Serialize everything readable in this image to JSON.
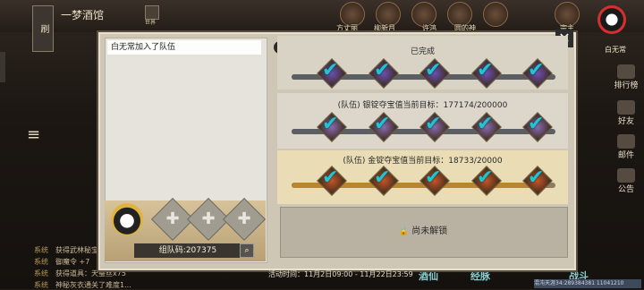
{
  "scene": {
    "location_title": "一梦酒馆",
    "refresh_label": "刷",
    "refresh_label2": "木",
    "map_label": "世界",
    "top_npcs": [
      "方丈丽",
      "柳新月",
      "",
      "许鸿",
      "圆的神",
      "",
      "宗主",
      "白无常"
    ],
    "right_menu": [
      "排行榜",
      "好友",
      "邮件",
      "公告"
    ],
    "chat": [
      {
        "tag": "系统",
        "text": "获得武林秘宝"
      },
      {
        "tag": "系统",
        "text": "御魔令 +7"
      },
      {
        "tag": "系统",
        "text": "获得道具：天蚕丝x75"
      },
      {
        "tag": "系统",
        "text": "神秘灰衣通关了难度1..."
      }
    ],
    "bottom_buttons": [
      "酒仙",
      "经脉",
      "",
      "战斗"
    ],
    "vip_text": "混沌天涯34:289384381 11041210"
  },
  "dialog": {
    "help_icon": "?",
    "close_icon": "✕",
    "left": {
      "message": "白无常加入了队伍",
      "team_code": "组队码:207375",
      "empty_slot_glyph": "✚"
    },
    "sections": [
      {
        "title": "已完成",
        "progress": 1.0,
        "fill_color": "#5b5e63",
        "chest_color": "#6b4fb3",
        "checks": [
          true,
          true,
          true,
          true,
          true
        ]
      },
      {
        "title": "(队伍) 银锭夺宝值当前目标：177174/200000",
        "progress": 0.88,
        "fill_color": "#5b5e63",
        "chest_color": "#8a6ab0",
        "checks": [
          true,
          true,
          true,
          true,
          true
        ]
      },
      {
        "title": "(队伍) 金锭夺宝值当前目标：18733/20000",
        "progress": 0.94,
        "fill_color": "#b9862f",
        "chest_color": "#c4552a",
        "checks": [
          true,
          true,
          true,
          true,
          true
        ]
      }
    ],
    "locked": {
      "text": "尚未解锁",
      "lock_icon": "🔒"
    },
    "event_time": "活动时间：11月2日09:00 - 11月22日23:59"
  }
}
